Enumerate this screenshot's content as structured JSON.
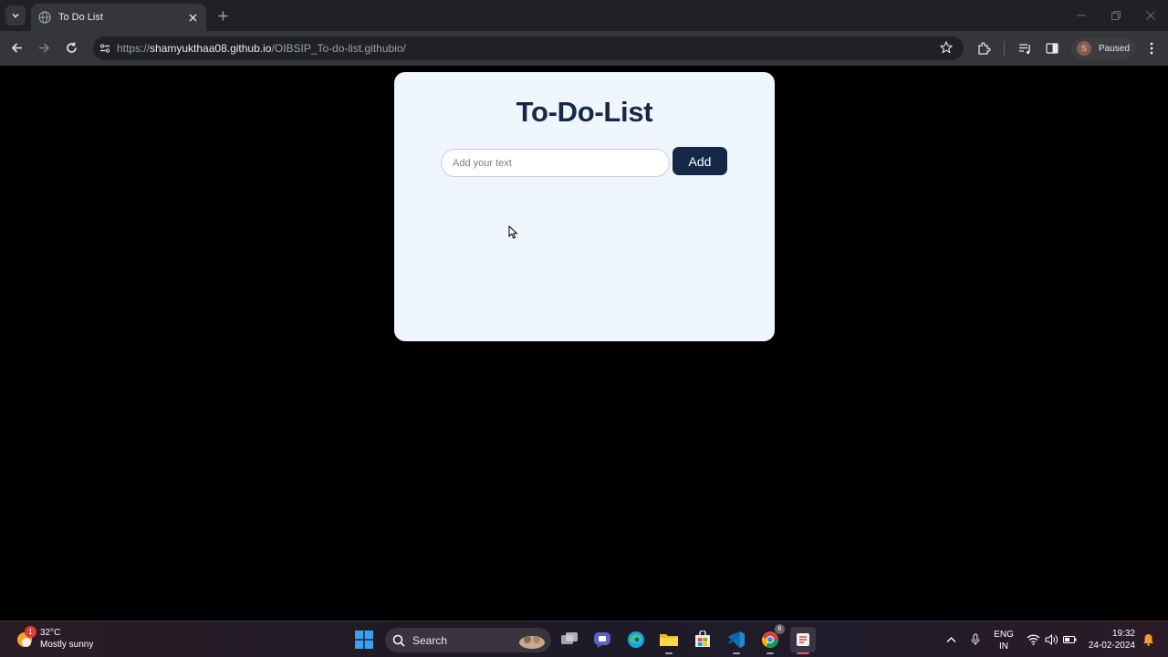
{
  "browser": {
    "tab_title": "To Do List",
    "url_scheme": "https://",
    "url_host": "shamyukthaa08.github.io",
    "url_path": "/OIBSIP_To-do-list.githubio/",
    "profile_initial": "S",
    "profile_label": "Paused"
  },
  "page": {
    "heading": "To-Do-List",
    "input_placeholder": "Add your text",
    "add_button_label": "Add",
    "colors": {
      "card_bg": "#eff6fd",
      "accent": "#162848",
      "page_bg": "#000000"
    }
  },
  "taskbar": {
    "weather_badge": "1",
    "temperature": "32°C",
    "condition": "Mostly sunny",
    "search_label": "Search",
    "chrome_badge": "6",
    "lang_line1": "ENG",
    "lang_line2": "IN",
    "time": "19:32",
    "date": "24-02-2024",
    "apps": [
      "windows-start-icon",
      "search-icon",
      "widgets-icon",
      "task-view-icon",
      "teams-chat-icon",
      "edge-icon",
      "file-explorer-icon",
      "store-icon",
      "vscode-icon",
      "chrome-icon",
      "snipping-tool-icon"
    ]
  }
}
